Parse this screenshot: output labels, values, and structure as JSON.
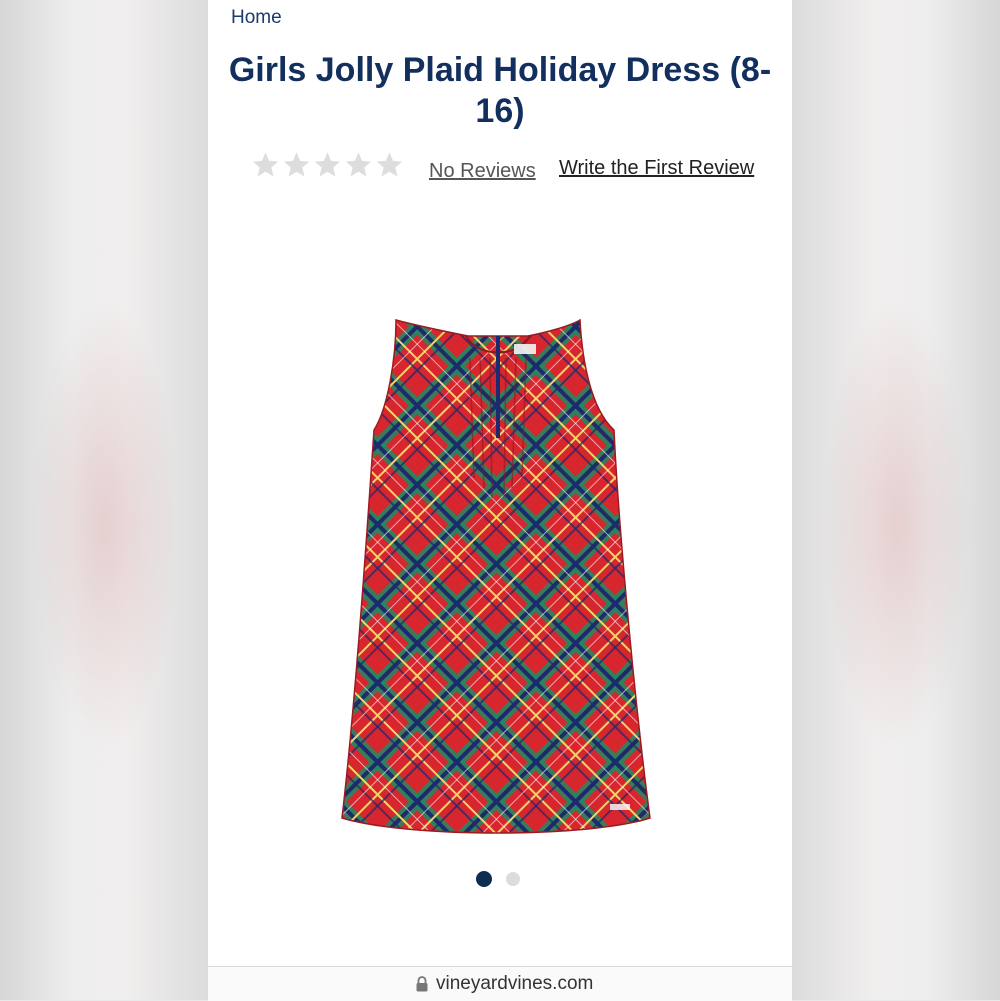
{
  "breadcrumb": {
    "label": "Home"
  },
  "product": {
    "title": "Girls Jolly Plaid Holiday Dress (8-16)",
    "image_icon": "plaid-dress-image"
  },
  "reviews": {
    "rating": 0,
    "max_rating": 5,
    "no_reviews_label": "No Reviews",
    "write_review_label": "Write the First Review"
  },
  "carousel": {
    "current": 1,
    "total": 2
  },
  "browser": {
    "url": "vineyardvines.com",
    "icon": "lock-icon"
  },
  "colors": {
    "title": "#132f5e",
    "star_empty": "#dddddd",
    "dot_active": "#0e2d52",
    "dot_inactive": "#dcdcdc",
    "plaid_red": "#d8262e",
    "plaid_green": "#1f8a63",
    "plaid_navy": "#1d2a6b"
  }
}
